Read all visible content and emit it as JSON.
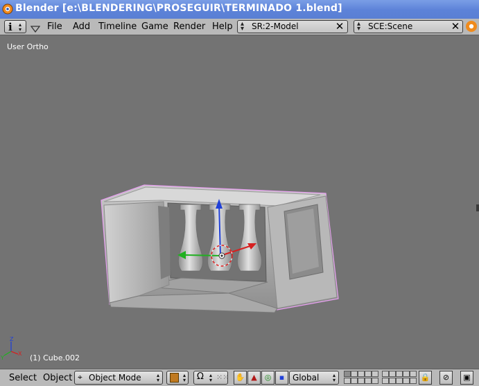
{
  "window": {
    "title": "Blender [e:\\BLENDERING\\PROSEGUIR\\TERMINADO 1.blend]"
  },
  "header": {
    "window_type_icon": "info-icon",
    "menus": [
      "File",
      "Add",
      "Timeline",
      "Game",
      "Render",
      "Help"
    ],
    "screen_field": "SR:2-Model",
    "scene_field": "SCE:Scene"
  },
  "viewport": {
    "view_label": "User Ortho",
    "object_label": "(1) Cube.002"
  },
  "footer": {
    "menus": [
      "Select",
      "Object"
    ],
    "mode": "Object Mode",
    "orientation": "Global"
  },
  "colors": {
    "titlebar": "#5c82d8",
    "header": "#b9b9b9",
    "viewport": "#737373",
    "selection_outline": "#e79ff0",
    "axis_x": "#d62020",
    "axis_y": "#20b020",
    "axis_z": "#2040d8"
  }
}
